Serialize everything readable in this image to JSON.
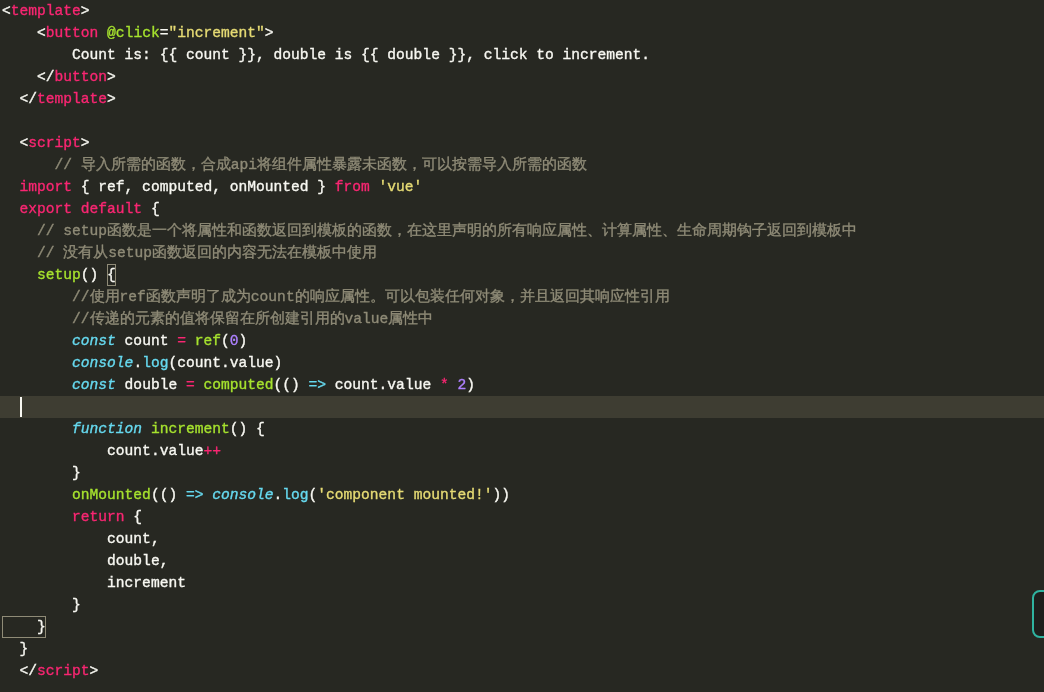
{
  "editor": {
    "template_block": {
      "lines": [
        {
          "tokens": [
            {
              "text": "<"
            },
            {
              "text": "template",
              "color": "#f92672"
            },
            {
              "text": ">"
            }
          ]
        },
        {
          "tokens": [
            {
              "text": "    <"
            },
            {
              "text": "button ",
              "color": "#f92672"
            },
            {
              "text": "@click",
              "color": "#a6e22e"
            },
            {
              "text": "="
            },
            {
              "text": "\"increment\"",
              "color": "#e6db74"
            },
            {
              "text": ">"
            }
          ]
        },
        {
          "tokens": [
            {
              "text": "        Count is: {{ count }}, double is {{ double }}, click to increment."
            }
          ]
        },
        {
          "tokens": [
            {
              "text": "    </"
            },
            {
              "text": "button",
              "color": "#f92672"
            },
            {
              "text": ">"
            }
          ]
        },
        {
          "tokens": [
            {
              "text": "  </"
            },
            {
              "text": "template",
              "color": "#f92672"
            },
            {
              "text": ">"
            }
          ]
        }
      ]
    },
    "script_block": {
      "lines": [
        {
          "tokens": [
            {
              "text": "  <"
            },
            {
              "text": "script",
              "color": "#f92672"
            },
            {
              "text": ">"
            }
          ]
        },
        {
          "tokens": [
            {
              "text": "      // 导入所需的函数，合成api将组件属性暴露未函数，可以按需导入所需的函数",
              "color": "#8f8b77"
            }
          ]
        },
        {
          "tokens": [
            {
              "text": "  import",
              "color": "#f92672"
            },
            {
              "text": " { ref, computed, onMounted } "
            },
            {
              "text": "from",
              "color": "#f92672"
            },
            {
              "text": " 'vue'",
              "color": "#e6db74"
            }
          ]
        },
        {
          "tokens": [
            {
              "text": "  export default",
              "color": "#f92672"
            },
            {
              "text": " {"
            }
          ]
        },
        {
          "tokens": [
            {
              "text": "    // setup函数是一个将属性和函数返回到模板的函数，在这里声明的所有响应属性、计算属性、生命周期钩子返回到模板中",
              "color": "#8f8b77"
            }
          ]
        },
        {
          "tokens": [
            {
              "text": "    // 没有从setup函数返回的内容无法在模板中使用",
              "color": "#8f8b77"
            }
          ]
        },
        {
          "tokens": [
            {
              "text": "    setup",
              "color": "#a6e22e"
            },
            {
              "text": "() "
            },
            {
              "text": "{",
              "matched": true
            }
          ]
        },
        {
          "tokens": [
            {
              "text": "        //使用ref函数声明了成为count的响应属性。可以包装任何对象，并且返回其响应性引用",
              "color": "#8f8b77"
            }
          ]
        },
        {
          "tokens": [
            {
              "text": "        //传递的元素的值将保留在所创建引用的value属性中",
              "color": "#8f8b77"
            }
          ]
        },
        {
          "tokens": [
            {
              "text": "        const",
              "color": "#66d9ef",
              "italic": true
            },
            {
              "text": " count "
            },
            {
              "text": "=",
              "color": "#f92672"
            },
            {
              "text": " ref",
              "color": "#a6e22e"
            },
            {
              "text": "("
            },
            {
              "text": "0",
              "color": "#ae81ff"
            },
            {
              "text": ")"
            }
          ]
        },
        {
          "tokens": [
            {
              "text": "        console",
              "color": "#66d9ef",
              "italic": true
            },
            {
              "text": "."
            },
            {
              "text": "log",
              "color": "#66d9ef"
            },
            {
              "text": "(count.value)"
            }
          ]
        },
        {
          "tokens": [
            {
              "text": "        const",
              "color": "#66d9ef",
              "italic": true
            },
            {
              "text": " double "
            },
            {
              "text": "=",
              "color": "#f92672"
            },
            {
              "text": " computed",
              "color": "#a6e22e"
            },
            {
              "text": "(() "
            },
            {
              "text": "=>",
              "color": "#66d9ef"
            },
            {
              "text": " count.value "
            },
            {
              "text": "*",
              "color": "#f92672"
            },
            {
              "text": " 2",
              "color": "#ae81ff"
            },
            {
              "text": ")"
            }
          ]
        },
        {
          "current": true
        },
        {
          "tokens": [
            {
              "text": "        function",
              "color": "#66d9ef",
              "italic": true
            },
            {
              "text": " increment",
              "color": "#a6e22e"
            },
            {
              "text": "() {"
            }
          ]
        },
        {
          "tokens": [
            {
              "text": "            count.value"
            },
            {
              "text": "++",
              "color": "#f92672"
            }
          ]
        },
        {
          "tokens": [
            {
              "text": "        }"
            }
          ]
        },
        {
          "tokens": [
            {
              "text": "        onMounted",
              "color": "#a6e22e"
            },
            {
              "text": "(() "
            },
            {
              "text": "=>",
              "color": "#66d9ef"
            },
            {
              "text": " console",
              "color": "#66d9ef",
              "italic": true
            },
            {
              "text": "."
            },
            {
              "text": "log",
              "color": "#66d9ef"
            },
            {
              "text": "("
            },
            {
              "text": "'component mounted!'",
              "color": "#e6db74"
            },
            {
              "text": "))"
            }
          ]
        },
        {
          "tokens": [
            {
              "text": "        return",
              "color": "#f92672"
            },
            {
              "text": " {"
            }
          ]
        },
        {
          "tokens": [
            {
              "text": "            count,"
            }
          ]
        },
        {
          "tokens": [
            {
              "text": "            double,"
            }
          ]
        },
        {
          "tokens": [
            {
              "text": "            increment"
            }
          ]
        },
        {
          "tokens": [
            {
              "text": "        }"
            }
          ]
        },
        {
          "tokens": [
            {
              "text": "    }",
              "matched": true
            }
          ]
        },
        {
          "tokens": [
            {
              "text": "  }"
            }
          ]
        },
        {
          "tokens": [
            {
              "text": "  </"
            },
            {
              "text": "script",
              "color": "#f92672"
            },
            {
              "text": ">"
            }
          ]
        }
      ]
    }
  }
}
